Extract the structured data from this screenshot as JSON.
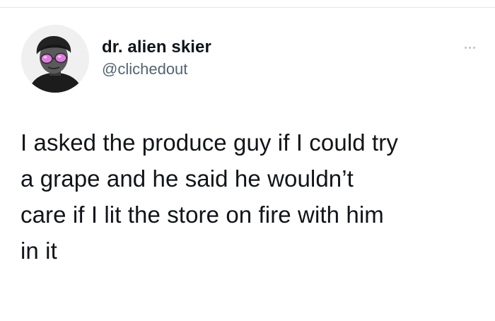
{
  "tweet": {
    "author": {
      "display_name": "dr. alien skier",
      "handle": "@clichedout",
      "avatar_icon": "profile-photo-avatar"
    },
    "more_icon": "more-options-icon",
    "text": "I asked the produce guy if I could try\na grape and he said he wouldn’t\ncare if I lit the store on fire with him\nin it"
  },
  "colors": {
    "background": "#ffffff",
    "text_primary": "#0f1419",
    "text_secondary": "#536471",
    "more_dots": "#b7c3cc",
    "avatar_lens": "#e07be0"
  }
}
